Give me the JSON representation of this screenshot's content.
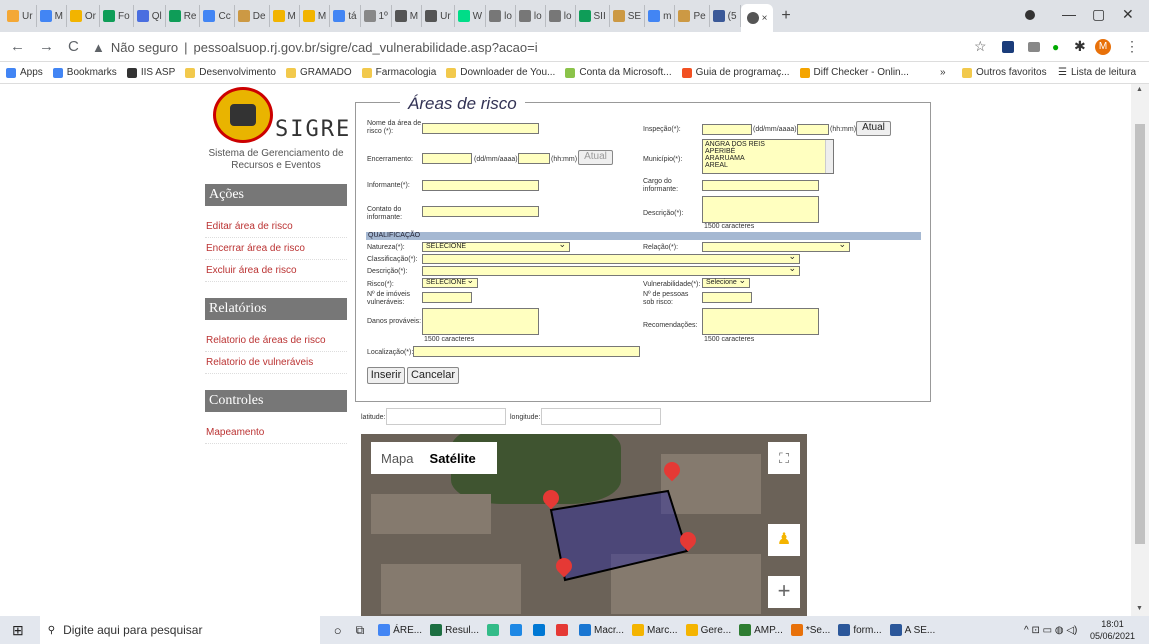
{
  "browser": {
    "tabs": [
      "Ur",
      "M",
      "Or",
      "Fo",
      "Ql",
      "Re",
      "Cc",
      "De",
      "M",
      "M",
      "tá",
      "1º",
      "M",
      "Ur",
      "W",
      "lo",
      "lo",
      "lo",
      "SII",
      "SE",
      "m",
      "Pe",
      "(5"
    ],
    "tab_colors": [
      "#f4a836",
      "#4285f4",
      "#f2b400",
      "#0f9d58",
      "#4a6ee0",
      "#0f9d58",
      "#4285f4",
      "#c94",
      "#f2b400",
      "#f2b400",
      "#4285f4",
      "#888",
      "#555",
      "#555",
      "#0d8",
      "#777",
      "#777",
      "#777",
      "#0f9d58",
      "#c94",
      "#4285f4",
      "#c94",
      "#3b5998"
    ],
    "active_tab_close": "×",
    "new_tab": "+",
    "back": "←",
    "forward": "→",
    "reload": "C",
    "security": "Não seguro",
    "url": "pessoalsuop.rj.gov.br/sigre/cad_vulnerabilidade.asp?acao=i",
    "bookmarks": [
      "Apps",
      "Bookmarks",
      "IIS ASP",
      "Desenvolvimento",
      "GRAMADO",
      "Farmacologia",
      "Downloader de You...",
      "Conta da Microsoft...",
      "Guia de programaç...",
      "Diff Checker - Onlin..."
    ],
    "bookmarks_more": "»",
    "other_favorites": "Outros favoritos",
    "reading_list": "Lista de leitura",
    "profile_initial": "M"
  },
  "sidebar": {
    "logo_text": "SIGRE",
    "logo_subtitle": "Sistema de Gerenciamento de Recursos e Eventos",
    "sections": [
      {
        "title": "Ações",
        "items": [
          "Editar área de risco",
          "Encerrar área de risco",
          "Excluir área de risco"
        ]
      },
      {
        "title": "Relatórios",
        "items": [
          "Relatorio de áreas de risco",
          "Relatorio de vulneráveis"
        ]
      },
      {
        "title": "Controles",
        "items": [
          "Mapeamento"
        ]
      }
    ]
  },
  "form": {
    "title": "Áreas de risco",
    "nome_label": "Nome da área de risco (*):",
    "inspecao_label": "Inspeção(*):",
    "date_fmt": "(dd/mm/aaaa)",
    "time_fmt": "(hh:mm)",
    "atual": "Atual",
    "encerramento_label": "Encerramento:",
    "municipio_label": "Município(*):",
    "municipios": [
      "ANGRA DOS REIS",
      "APERIBÉ",
      "ARARUAMA",
      "AREAL"
    ],
    "informante_label": "Informante(*):",
    "cargo_label": "Cargo do informante:",
    "contato_label": "Contato do informante:",
    "descricao_label": "Descrição(*):",
    "chars": "1500 caracteres",
    "qualificacao": "QUALIFICAÇÃO",
    "natureza_label": "Natureza(*):",
    "natureza_value": "SELECIONE",
    "relacao_label": "Relação(*):",
    "classificacao_label": "Classificação(*):",
    "descricao2_label": "Descrição(*):",
    "risco_label": "Risco(*):",
    "risco_value": "SELECIONE",
    "vulnerabilidade_label": "Vulnerabilidade(*):",
    "vulnerabilidade_value": "Selecione",
    "imoveis_label": "Nº de imóveis vulneráveis:",
    "pessoas_label": "Nº de pessoas sob risco:",
    "danos_label": "Danos prováveis:",
    "recomendacoes_label": "Recomendações:",
    "localizacao_label": "Localização(*):",
    "inserir": "Inserir",
    "cancelar": "Cancelar",
    "latitude_label": "latitude:",
    "longitude_label": "longitude:"
  },
  "map": {
    "type_map": "Mapa",
    "type_satellite": "Satélite",
    "zoom_in": "+",
    "fullscreen": "⛶"
  },
  "taskbar": {
    "search": "Digite aqui para pesquisar",
    "apps": [
      "ÁRE...",
      "Resul...",
      "",
      "",
      "",
      "",
      "Macr...",
      "Marc...",
      "Gere...",
      "AMP...",
      "*Se...",
      "form...",
      "A SE..."
    ],
    "time": "18:01",
    "date": "05/06/2021"
  }
}
